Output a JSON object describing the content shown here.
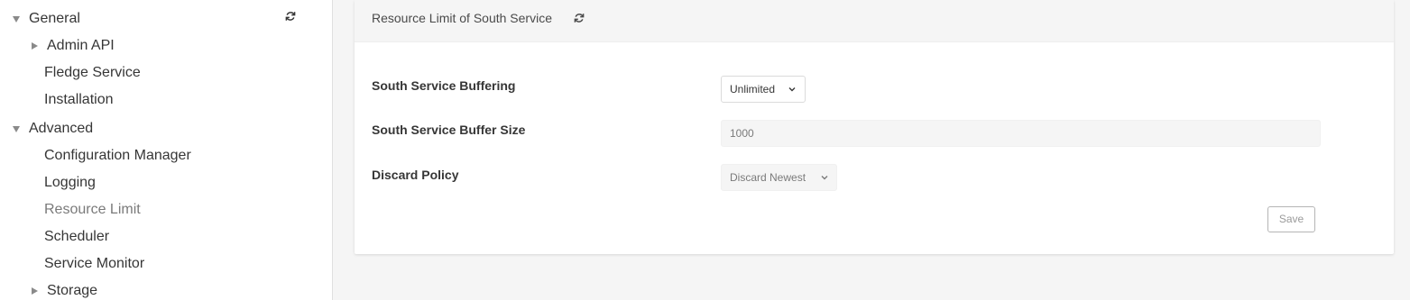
{
  "sidebar": {
    "items": [
      {
        "label": "General",
        "kind": "group-expanded"
      },
      {
        "label": "Admin API",
        "kind": "group-collapsed"
      },
      {
        "label": "Fledge Service",
        "kind": "leaf"
      },
      {
        "label": "Installation",
        "kind": "leaf"
      },
      {
        "label": "Advanced",
        "kind": "group-expanded"
      },
      {
        "label": "Configuration Manager",
        "kind": "leaf"
      },
      {
        "label": "Logging",
        "kind": "leaf"
      },
      {
        "label": "Resource Limit",
        "kind": "leaf",
        "active": true
      },
      {
        "label": "Scheduler",
        "kind": "leaf"
      },
      {
        "label": "Service Monitor",
        "kind": "leaf"
      },
      {
        "label": "Storage",
        "kind": "group-collapsed"
      }
    ],
    "refresh_icon": "refresh-icon"
  },
  "panel": {
    "title": "Resource Limit of South Service",
    "refresh_icon": "refresh-icon",
    "fields": {
      "buffering": {
        "label": "South Service Buffering",
        "value": "Unlimited"
      },
      "buffer_size": {
        "label": "South Service Buffer Size",
        "value": "1000"
      },
      "discard_policy": {
        "label": "Discard Policy",
        "value": "Discard Newest"
      }
    },
    "save_label": "Save"
  },
  "colors": {
    "page_bg": "#f5f5f5",
    "card_bg": "#ffffff",
    "text": "#363636",
    "muted": "#7a7a7a"
  }
}
